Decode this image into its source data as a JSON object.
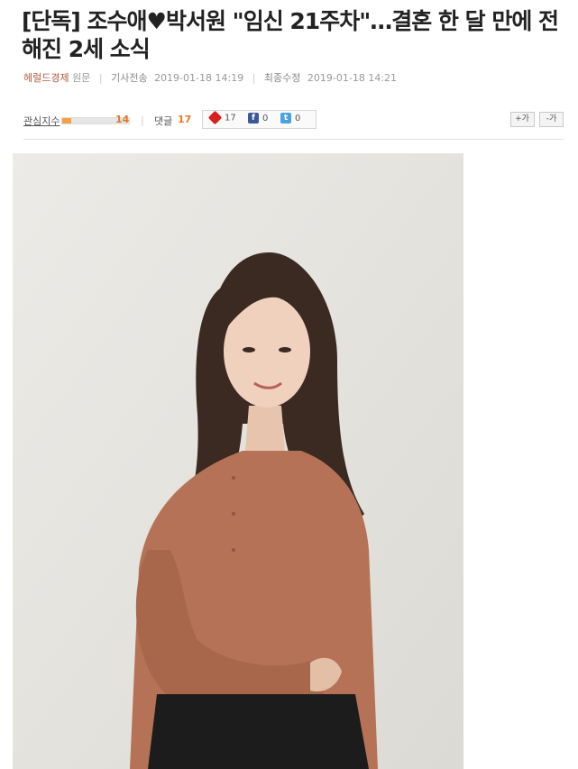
{
  "article": {
    "headline": "[단독] 조수애♥박서원 \"임신 21주차\"…결혼 한 달 만에 전해진 2세 소식",
    "source": "헤럴드경제",
    "original": "원문",
    "sent_label": "기사전송",
    "sent_time": "2019-01-18 14:19",
    "modified_label": "최종수정",
    "modified_time": "2019-01-18 14:21"
  },
  "toolbar": {
    "interest_label": "관심지수",
    "interest_value": "14",
    "interest_level": 0.14,
    "comments_label": "댓글",
    "comments_count": "17",
    "share_main_count": "17",
    "share_fb_count": "0",
    "share_tw_count": "0",
    "font_up_label": "+가",
    "font_down_label": "-가"
  },
  "colors": {
    "accent_orange": "#e87722",
    "source_brown": "#b05a3a",
    "facebook": "#3b5998",
    "twitter": "#4aa3df"
  },
  "icons": [
    "share-count-icon",
    "facebook-icon",
    "twitter-icon"
  ]
}
